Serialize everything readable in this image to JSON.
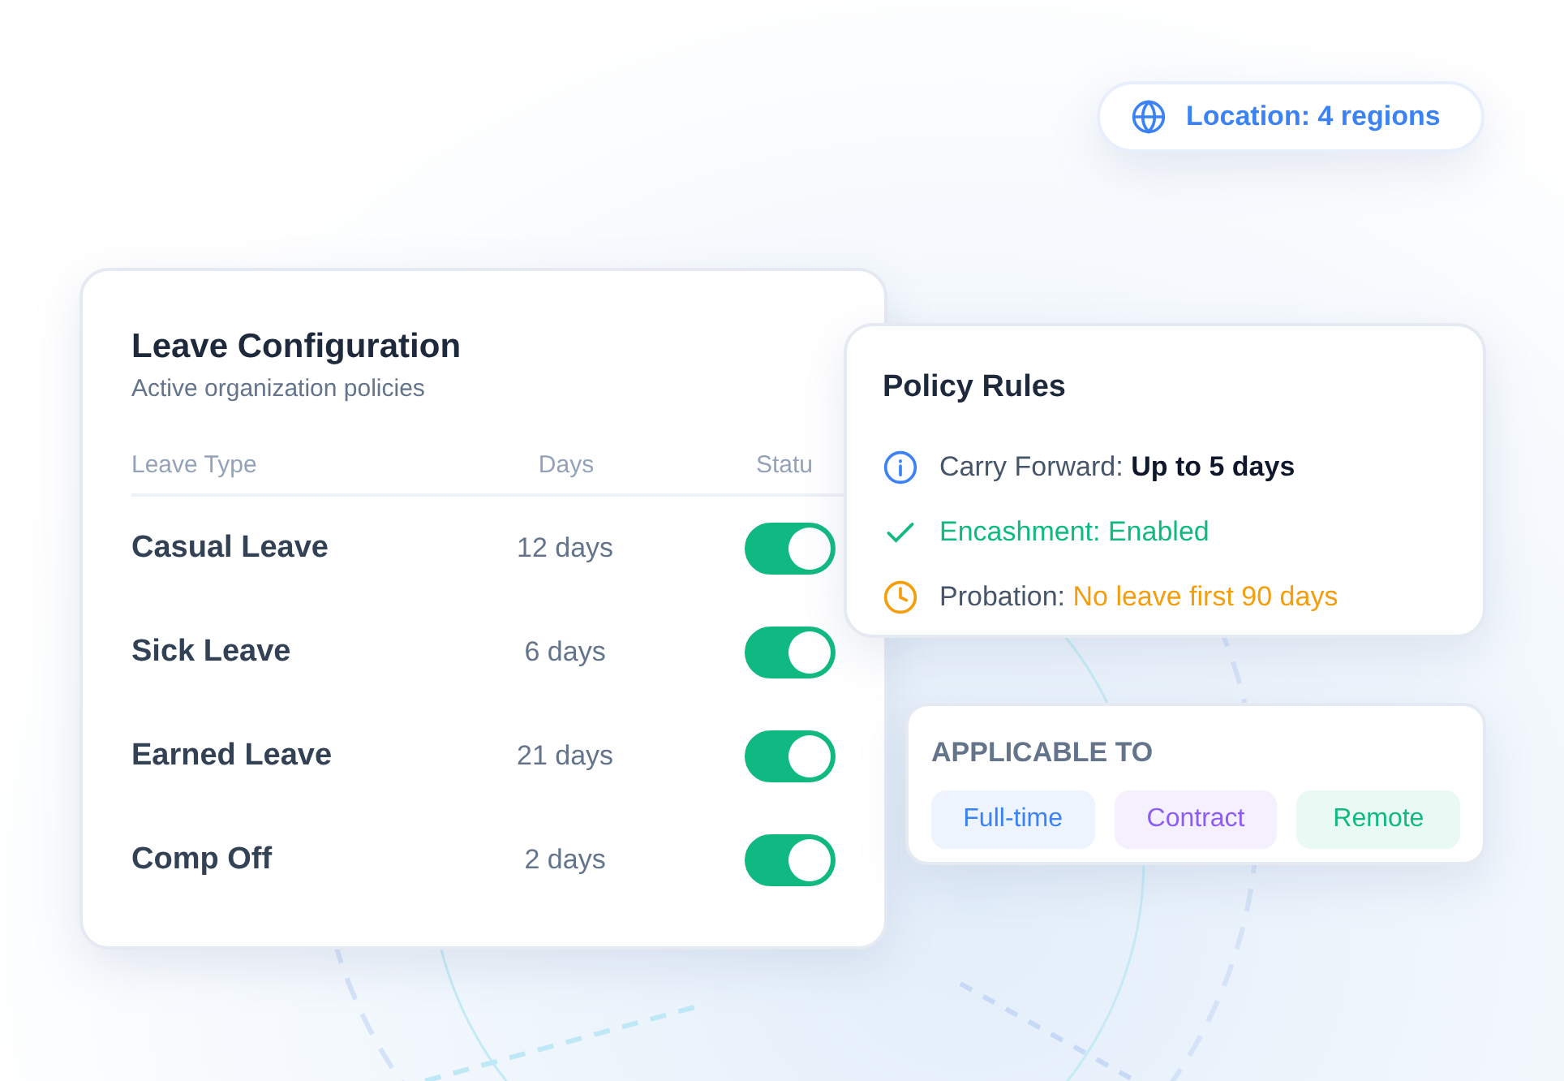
{
  "location_pill": {
    "label": "Location: 4 regions"
  },
  "leave_card": {
    "title": "Leave Configuration",
    "subtitle": "Active organization policies",
    "columns": [
      "Leave Type",
      "Days",
      "Statu"
    ],
    "rows": [
      {
        "type": "Casual Leave",
        "days": "12 days",
        "on": true
      },
      {
        "type": "Sick Leave",
        "days": "6 days",
        "on": true
      },
      {
        "type": "Earned Leave",
        "days": "21 days",
        "on": true
      },
      {
        "type": "Comp Off",
        "days": "2 days",
        "on": true
      }
    ]
  },
  "policy_card": {
    "title": "Policy Rules",
    "rules": [
      {
        "kind": "info",
        "label": "Carry Forward:",
        "value": "Up to 5 days"
      },
      {
        "kind": "check",
        "label": "Encashment:",
        "value": "Enabled"
      },
      {
        "kind": "clock",
        "label": "Probation:",
        "value": "No leave first 90 days"
      }
    ]
  },
  "applicable_card": {
    "title": "APPLICABLE TO",
    "tags": [
      {
        "label": "Full-time",
        "color": "#3b82f6"
      },
      {
        "label": "Contract",
        "color": "#8b5cf6"
      },
      {
        "label": "Remote",
        "color": "#10b981"
      }
    ]
  }
}
